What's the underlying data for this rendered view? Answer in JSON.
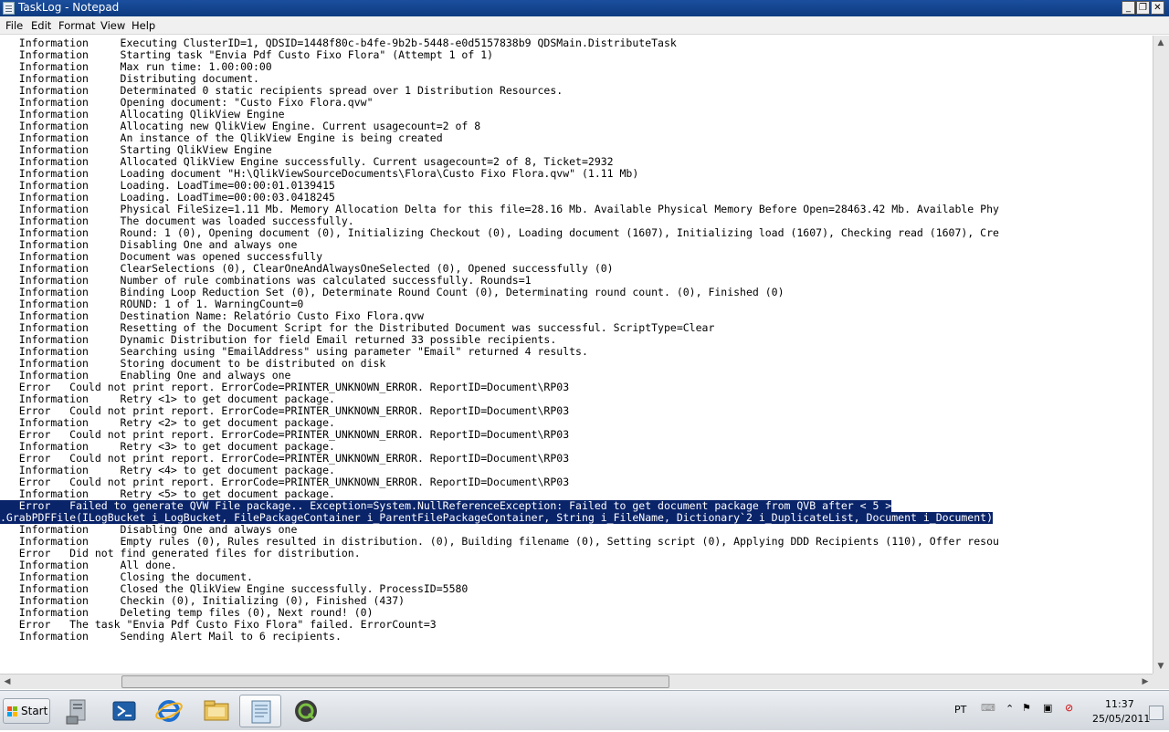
{
  "window": {
    "title": "TaskLog - Notepad"
  },
  "menu": [
    "File",
    "Edit",
    "Format",
    "View",
    "Help"
  ],
  "log_lines": [
    "   Information     Executing ClusterID=1, QDSID=1448f80c-b4fe-9b2b-5448-e0d5157838b9 QDSMain.DistributeTask",
    "   Information     Starting task \"Envia Pdf Custo Fixo Flora\" (Attempt 1 of 1)",
    "   Information     Max run time: 1.00:00:00",
    "   Information     Distributing document.",
    "   Information     Determinated 0 static recipients spread over 1 Distribution Resources.",
    "   Information     Opening document: \"Custo Fixo Flora.qvw\"",
    "   Information     Allocating QlikView Engine",
    "   Information     Allocating new QlikView Engine. Current usagecount=2 of 8",
    "   Information     An instance of the QlikView Engine is being created",
    "   Information     Starting QlikView Engine",
    "   Information     Allocated QlikView Engine successfully. Current usagecount=2 of 8, Ticket=2932",
    "   Information     Loading document \"H:\\QlikViewSourceDocuments\\Flora\\Custo Fixo Flora.qvw\" (1.11 Mb)",
    "   Information     Loading. LoadTime=00:00:01.0139415",
    "   Information     Loading. LoadTime=00:00:03.0418245",
    "   Information     Physical FileSize=1.11 Mb. Memory Allocation Delta for this file=28.16 Mb. Available Physical Memory Before Open=28463.42 Mb. Available Phy",
    "   Information     The document was loaded successfully.",
    "   Information     Round: 1 (0), Opening document (0), Initializing Checkout (0), Loading document (1607), Initializing load (1607), Checking read (1607), Cre",
    "   Information     Disabling One and always one",
    "   Information     Document was opened successfully",
    "   Information     ClearSelections (0), ClearOneAndAlwaysOneSelected (0), Opened successfully (0)",
    "   Information     Number of rule combinations was calculated successfully. Rounds=1",
    "   Information     Binding Loop Reduction Set (0), Determinate Round Count (0), Determinating round count. (0), Finished (0)",
    "   Information     ROUND: 1 of 1. WarningCount=0",
    "   Information     Destination Name: Relatório Custo Fixo Flora.qvw",
    "   Information     Resetting of the Document Script for the Distributed Document was successful. ScriptType=Clear",
    "   Information     Dynamic Distribution for field Email returned 33 possible recipients.",
    "   Information     Searching using \"EmailAddress\" using parameter \"Email\" returned 4 results.",
    "   Information     Storing document to be distributed on disk",
    "   Information     Enabling One and always one",
    "   Error   Could not print report. ErrorCode=PRINTER_UNKNOWN_ERROR. ReportID=Document\\RP03",
    "   Information     Retry <1> to get document package.",
    "   Error   Could not print report. ErrorCode=PRINTER_UNKNOWN_ERROR. ReportID=Document\\RP03",
    "   Information     Retry <2> to get document package.",
    "   Error   Could not print report. ErrorCode=PRINTER_UNKNOWN_ERROR. ReportID=Document\\RP03",
    "   Information     Retry <3> to get document package.",
    "   Error   Could not print report. ErrorCode=PRINTER_UNKNOWN_ERROR. ReportID=Document\\RP03",
    "   Information     Retry <4> to get document package.",
    "   Error   Could not print report. ErrorCode=PRINTER_UNKNOWN_ERROR. ReportID=Document\\RP03",
    "   Information     Retry <5> to get document package.",
    "   Error   Failed to generate QVW File package.. Exception=System.NullReferenceException: Failed to get document package from QVB after < 5 >",
    ".GrabPDFFile(ILogBucket i_LogBucket, FilePackageContainer i_ParentFilePackageContainer, String i_FileName, Dictionary`2 i_DuplicateList, Document i_Document)",
    "   Information     Disabling One and always one",
    "   Information     Empty rules (0), Rules resulted in distribution. (0), Building filename (0), Setting script (0), Applying DDD Recipients (110), Offer resou",
    "   Error   Did not find generated files for distribution.",
    "   Information     All done.",
    "   Information     Closing the document.",
    "   Information     Closed the QlikView Engine successfully. ProcessID=5580",
    "   Information     Checkin (0), Initializing (0), Finished (437)",
    "   Information     Deleting temp files (0), Next round! (0)",
    "   Error   The task \"Envia Pdf Custo Fixo Flora\" failed. ErrorCount=3",
    "   Information     Sending Alert Mail to 6 recipients."
  ],
  "selected_lines": [
    39,
    40
  ],
  "taskbar": {
    "start_label": "Start",
    "items": [
      "server-manager-icon",
      "powershell-icon",
      "internet-explorer-icon",
      "windows-explorer-icon",
      "notepad-icon",
      "qlikview-icon"
    ],
    "active_item": "notepad-icon"
  },
  "tray": {
    "language": "PT",
    "time": "11:37",
    "date": "25/05/2011"
  },
  "colors": {
    "selection": "#0a246a",
    "title_bar": "#1b4f9e"
  }
}
